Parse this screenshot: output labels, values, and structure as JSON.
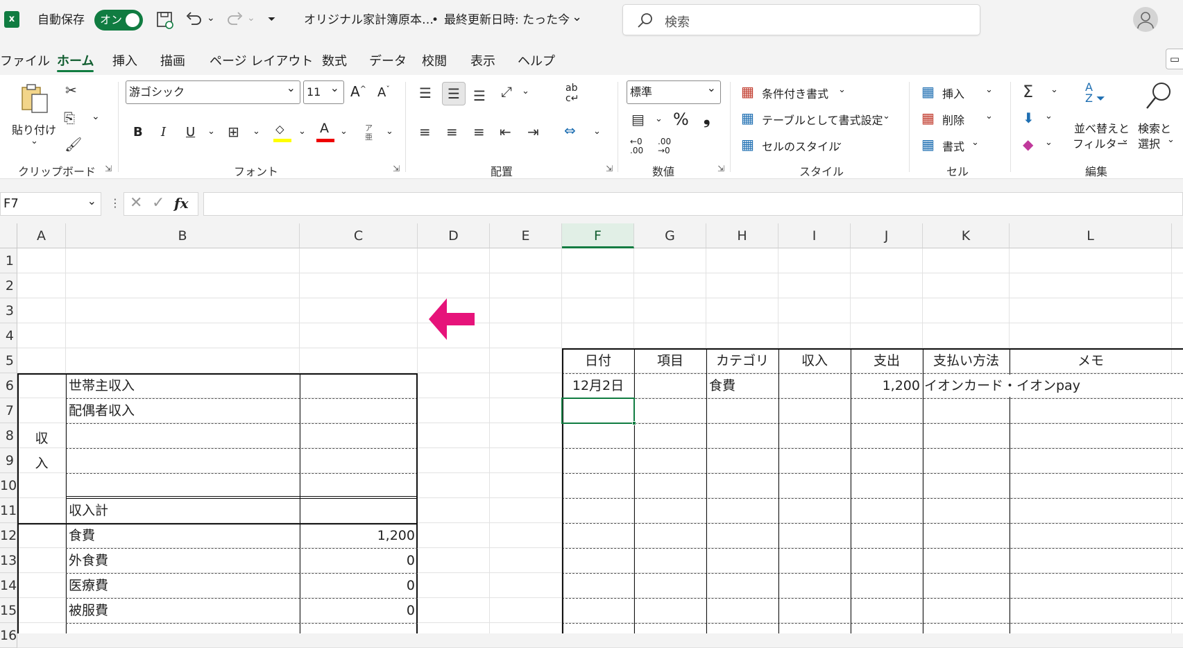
{
  "titlebar": {
    "autosave_label": "自動保存",
    "autosave_state": "オン",
    "doc_title": "オリジナル家計簿原本…",
    "save_status": "最終更新日時: たった今",
    "search_placeholder": "検索"
  },
  "menu": [
    "ファイル",
    "ホーム",
    "挿入",
    "描画",
    "ページ レイアウト",
    "数式",
    "データ",
    "校閲",
    "表示",
    "ヘルプ"
  ],
  "ribbon": {
    "clipboard": {
      "paste": "貼り付け",
      "label": "クリップボード"
    },
    "font": {
      "name": "游ゴシック",
      "size": "11",
      "bold": "B",
      "italic": "I",
      "underline": "U",
      "label": "フォント"
    },
    "alignment": {
      "label": "配置"
    },
    "number": {
      "format": "標準",
      "percent": "%",
      "comma": "❟",
      "label": "数値"
    },
    "styles": {
      "conditional": "条件付き書式",
      "table": "テーブルとして書式設定",
      "cell_styles": "セルのスタイル",
      "label": "スタイル"
    },
    "cells": {
      "insert": "挿入",
      "delete": "削除",
      "format": "書式",
      "label": "セル"
    },
    "editing": {
      "sort1": "並べ替えと",
      "sort2": "フィルター",
      "find1": "検索と",
      "find2": "選択",
      "label": "編集"
    }
  },
  "formula_bar": {
    "name_box": "F7",
    "fx": "fx",
    "value": ""
  },
  "columns": [
    {
      "id": "A",
      "w": 70
    },
    {
      "id": "B",
      "w": 337
    },
    {
      "id": "C",
      "w": 170
    },
    {
      "id": "D",
      "w": 104
    },
    {
      "id": "E",
      "w": 104
    },
    {
      "id": "F",
      "w": 104
    },
    {
      "id": "G",
      "w": 104
    },
    {
      "id": "H",
      "w": 104
    },
    {
      "id": "I",
      "w": 104
    },
    {
      "id": "J",
      "w": 104
    },
    {
      "id": "K",
      "w": 125
    },
    {
      "id": "L",
      "w": 234
    }
  ],
  "rows": [
    "1",
    "2",
    "3",
    "4",
    "5",
    "6",
    "7",
    "8",
    "9",
    "10",
    "11",
    "12",
    "13",
    "14",
    "15",
    "16"
  ],
  "selected_cell": "F7",
  "income_block": {
    "side_label": [
      "収",
      "入"
    ],
    "items": [
      "世帯主収入",
      "配偶者収入",
      "",
      "",
      ""
    ],
    "total_label": "収入計"
  },
  "expense_block": {
    "items": [
      {
        "name": "食費",
        "amount": "1,200"
      },
      {
        "name": "外食費",
        "amount": "0"
      },
      {
        "name": "医療費",
        "amount": "0"
      },
      {
        "name": "被服費",
        "amount": "0"
      }
    ]
  },
  "ledger": {
    "headers": [
      "日付",
      "項目",
      "カテゴリ",
      "収入",
      "支出",
      "支払い方法",
      "メモ"
    ],
    "rows": [
      {
        "date": "12月2日",
        "item": "",
        "category": "食費",
        "income": "",
        "expense": "1,200",
        "method": "イオンカード・イオンpay",
        "memo": ""
      }
    ]
  },
  "colors": {
    "excel_green": "#107c41",
    "arrow": "#e6137a"
  }
}
